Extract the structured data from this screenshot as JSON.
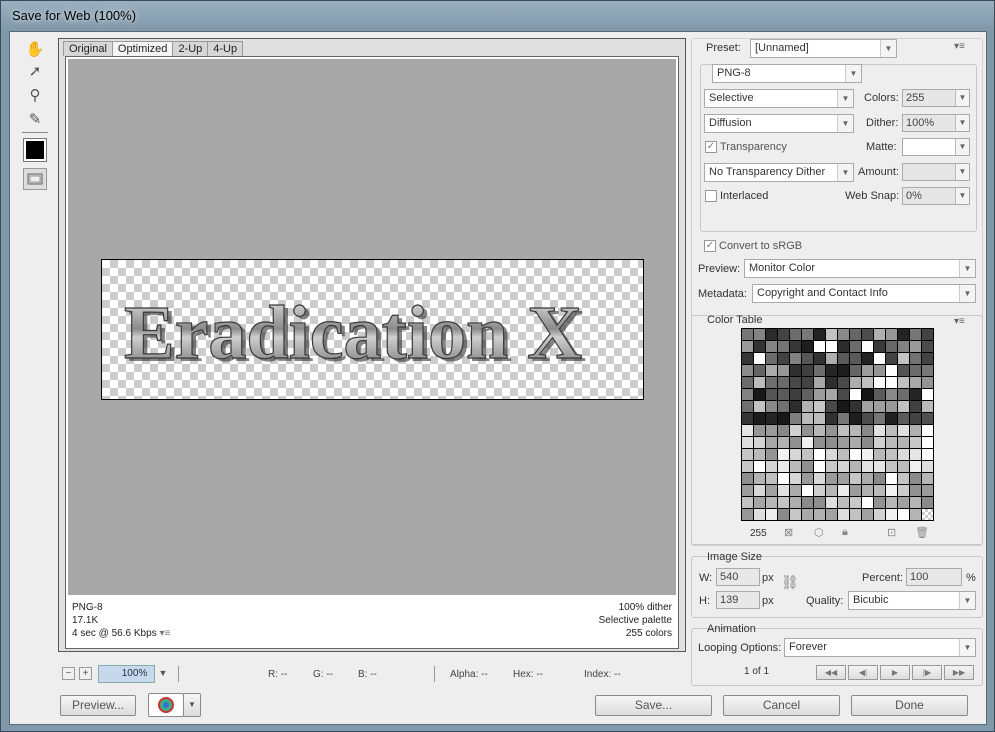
{
  "window": {
    "title": "Save for Web (100%)"
  },
  "tabs": [
    "Original",
    "Optimized",
    "2-Up",
    "4-Up"
  ],
  "image": {
    "text": "Eradication X"
  },
  "info": {
    "left": [
      "PNG-8",
      "17.1K",
      "4 sec @ 56.6 Kbps"
    ],
    "right": [
      "100% dither",
      "Selective palette",
      "255 colors"
    ]
  },
  "status": {
    "zoom": "100%",
    "r": "R: --",
    "g": "G: --",
    "b": "B: --",
    "alpha": "Alpha: --",
    "hex": "Hex: --",
    "index": "Index: --"
  },
  "buttons": {
    "preview": "Preview...",
    "save": "Save...",
    "cancel": "Cancel",
    "done": "Done"
  },
  "settings": {
    "preset_label": "Preset:",
    "preset_value": "[Unnamed]",
    "format": "PNG-8",
    "reduction": "Selective",
    "colors_label": "Colors:",
    "colors_value": "255",
    "dither_algo": "Diffusion",
    "dither_label": "Dither:",
    "dither_value": "100%",
    "transparency_label": "Transparency",
    "matte_label": "Matte:",
    "trans_dither": "No Transparency Dither",
    "amount_label": "Amount:",
    "interlaced_label": "Interlaced",
    "websnap_label": "Web Snap:",
    "websnap_value": "0%",
    "srgb_label": "Convert to sRGB",
    "preview_label": "Preview:",
    "preview_value": "Monitor Color",
    "metadata_label": "Metadata:",
    "metadata_value": "Copyright and Contact Info"
  },
  "color_table": {
    "title": "Color Table",
    "count": "255"
  },
  "image_size": {
    "title": "Image Size",
    "w_label": "W:",
    "w_value": "540",
    "h_label": "H:",
    "h_value": "139",
    "unit": "px",
    "percent_label": "Percent:",
    "percent_value": "100",
    "percent_unit": "%",
    "quality_label": "Quality:",
    "quality_value": "Bicubic"
  },
  "animation": {
    "title": "Animation",
    "looping_label": "Looping Options:",
    "looping_value": "Forever",
    "frame": "1 of 1"
  }
}
